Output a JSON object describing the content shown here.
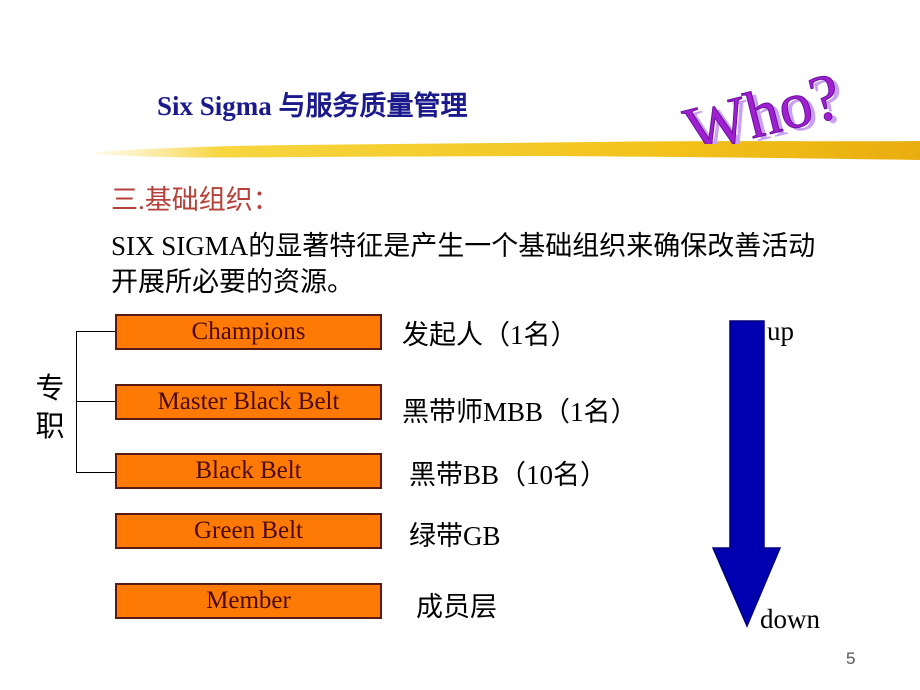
{
  "slide": {
    "title": "Six Sigma 与服务质量管理",
    "decoration_text": "Who?",
    "section_heading": "三.基础组织：",
    "paragraph": "SIX SIGMA的显著特征是产生一个基础组织来确保改善活动开展所必要的资源。",
    "side_label": "专职",
    "roles": [
      {
        "name": "Champions",
        "description": "发起人（1名）"
      },
      {
        "name": "Master Black Belt",
        "description": "黑带师MBB（1名）"
      },
      {
        "name": "Black Belt",
        "description": "黑带BB（10名）"
      },
      {
        "name": "Green Belt",
        "description": "绿带GB"
      },
      {
        "name": "Member",
        "description": "成员层"
      }
    ],
    "arrow": {
      "top_label": "up",
      "bottom_label": "down"
    },
    "page_number": "5"
  },
  "colors": {
    "title": "#1a1a8c",
    "section_heading": "#b5423a",
    "role_box_fill": "#ff7a05",
    "role_box_border": "#5a1a10",
    "arrow_fill": "#0000b0",
    "who_text": "#a020d0",
    "brush": "#f2c21a"
  }
}
